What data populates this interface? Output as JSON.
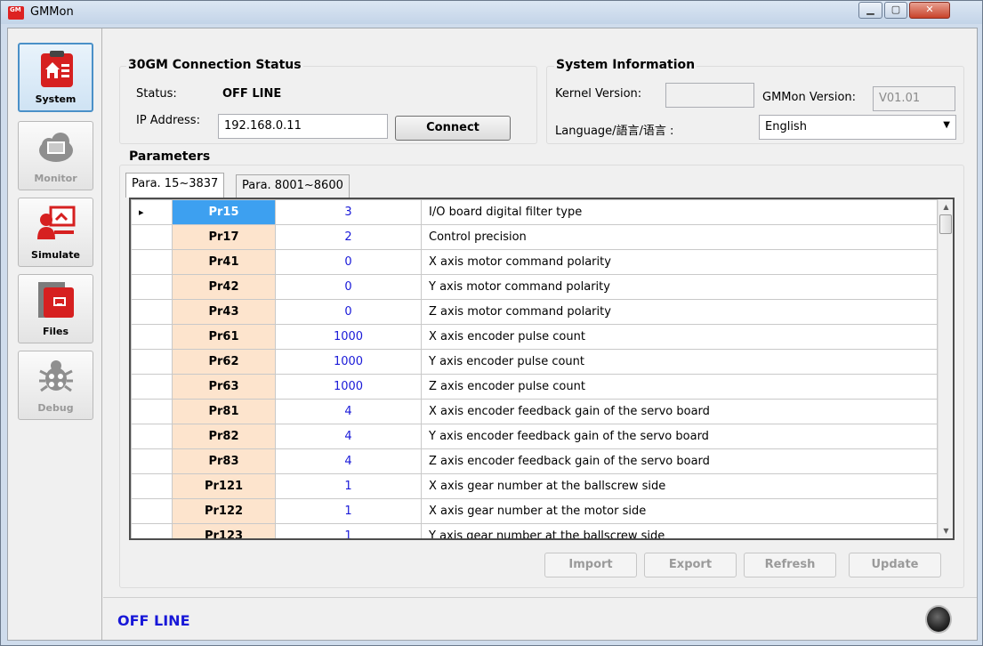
{
  "window": {
    "title": "GMMon",
    "app_icon": "GM"
  },
  "sidebar": {
    "items": [
      {
        "label": "System",
        "icon": "home-list-icon",
        "active": true,
        "enabled": true
      },
      {
        "label": "Monitor",
        "icon": "monitor-cloud-icon",
        "active": false,
        "enabled": false
      },
      {
        "label": "Simulate",
        "icon": "presenter-icon",
        "active": false,
        "enabled": true
      },
      {
        "label": "Files",
        "icon": "file-cabinet-icon",
        "active": false,
        "enabled": true
      },
      {
        "label": "Debug",
        "icon": "bug-icon",
        "active": false,
        "enabled": false
      }
    ]
  },
  "connection": {
    "title": "30GM Connection Status",
    "status_label": "Status:",
    "status_value": "OFF LINE",
    "ip_label": "IP Address:",
    "ip_value": "192.168.0.11",
    "connect_label": "Connect"
  },
  "sysinfo": {
    "title": "System Information",
    "kernel_label": "Kernel Version:",
    "kernel_value": "",
    "gmmon_label": "GMMon Version:",
    "gmmon_value": "V01.01",
    "language_label": "Language/語言/语言 :",
    "language_value": "English"
  },
  "parameters": {
    "title": "Parameters",
    "tabs": [
      {
        "label": "Para. 15~3837"
      },
      {
        "label": "Para. 8001~8600"
      }
    ],
    "rows": [
      {
        "id": "Pr15",
        "value": "3",
        "desc": "I/O board digital filter type"
      },
      {
        "id": "Pr17",
        "value": "2",
        "desc": "Control precision"
      },
      {
        "id": "Pr41",
        "value": "0",
        "desc": "X axis motor command polarity"
      },
      {
        "id": "Pr42",
        "value": "0",
        "desc": "Y axis motor command polarity"
      },
      {
        "id": "Pr43",
        "value": "0",
        "desc": "Z axis motor command polarity"
      },
      {
        "id": "Pr61",
        "value": "1000",
        "desc": "X axis encoder pulse count"
      },
      {
        "id": "Pr62",
        "value": "1000",
        "desc": "Y axis encoder pulse count"
      },
      {
        "id": "Pr63",
        "value": "1000",
        "desc": "Z axis encoder pulse count"
      },
      {
        "id": "Pr81",
        "value": "4",
        "desc": "X axis encoder feedback gain of the servo board"
      },
      {
        "id": "Pr82",
        "value": "4",
        "desc": "Y axis encoder feedback gain of the servo board"
      },
      {
        "id": "Pr83",
        "value": "4",
        "desc": "Z axis encoder feedback gain of the servo board"
      },
      {
        "id": "Pr121",
        "value": "1",
        "desc": "X axis gear number at the ballscrew side"
      },
      {
        "id": "Pr122",
        "value": "1",
        "desc": "X axis gear number at the motor side"
      },
      {
        "id": "Pr123",
        "value": "1",
        "desc": "Y axis gear number at the ballscrew side"
      }
    ],
    "buttons": {
      "import": "Import",
      "export": "Export",
      "refresh": "Refresh",
      "update": "Update"
    }
  },
  "statusbar": {
    "text": "OFF LINE"
  },
  "colors": {
    "accent": "#3da0f0",
    "id_cell": "#fde4cd",
    "value_text": "#1a1ad8",
    "status_text": "#1818d8",
    "brand_red": "#d22222"
  }
}
